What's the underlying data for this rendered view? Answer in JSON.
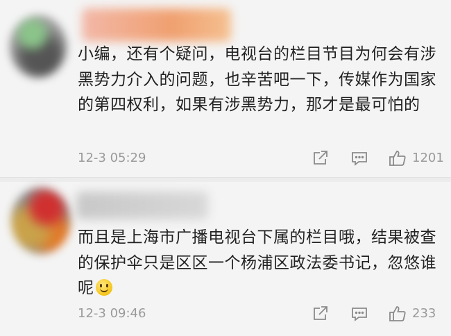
{
  "comments": [
    {
      "text": "小编，还有个疑问，电视台的栏目节目为何会有涉黑势力介入的问题，也辛苦吧一下，传媒作为国家的第四权利，如果有涉黑势力，那才是最可怕的",
      "time": "12-3 05:29",
      "likes": "1201"
    },
    {
      "text": "而且是上海市广播电视台下属的栏目哦，结果被查的保护伞只是区区一个杨浦区政法委书记，忽悠谁呢",
      "emoji": "smiley-emoji",
      "time": "12-3 09:46",
      "likes": "233"
    }
  ],
  "icons": {
    "share": "share-icon",
    "reply": "reply-icon",
    "like": "thumbs-up-icon"
  },
  "colors": {
    "background": "#f4f4f4",
    "text": "#222222",
    "meta": "#9a9a9a"
  }
}
